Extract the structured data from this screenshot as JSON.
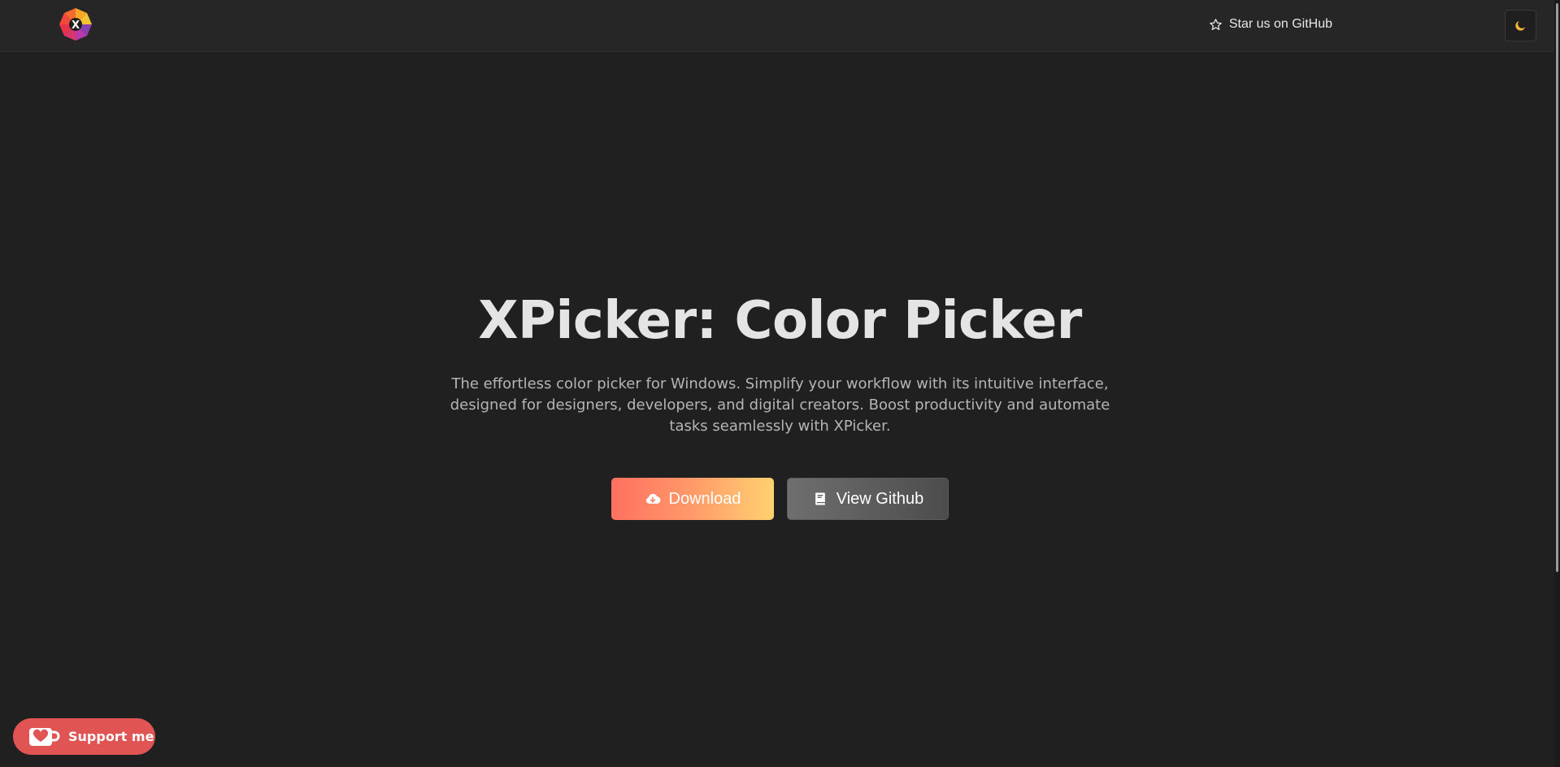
{
  "header": {
    "logo_letter": "X",
    "github_link_label": "Star us on GitHub",
    "theme_toggle_icon": "moon-icon"
  },
  "hero": {
    "title": "XPicker: Color Picker",
    "description": "The effortless color picker for Windows. Simplify your workflow with its intuitive interface, designed for designers, developers, and digital creators. Boost productivity and automate tasks seamlessly with XPicker.",
    "download_label": "Download",
    "download_icon": "cloud-download-icon",
    "github_label": "View Github",
    "github_icon": "book-icon"
  },
  "support": {
    "label": "Support me",
    "icon": "kofi-cup-icon"
  },
  "colors": {
    "background": "#202020",
    "header": "#262626",
    "download_gradient_start": "#ff7060",
    "download_gradient_end": "#ffd170",
    "github_button": "#5a5a5a",
    "support_button": "#e05454",
    "moon_icon": "#f5b43a"
  }
}
